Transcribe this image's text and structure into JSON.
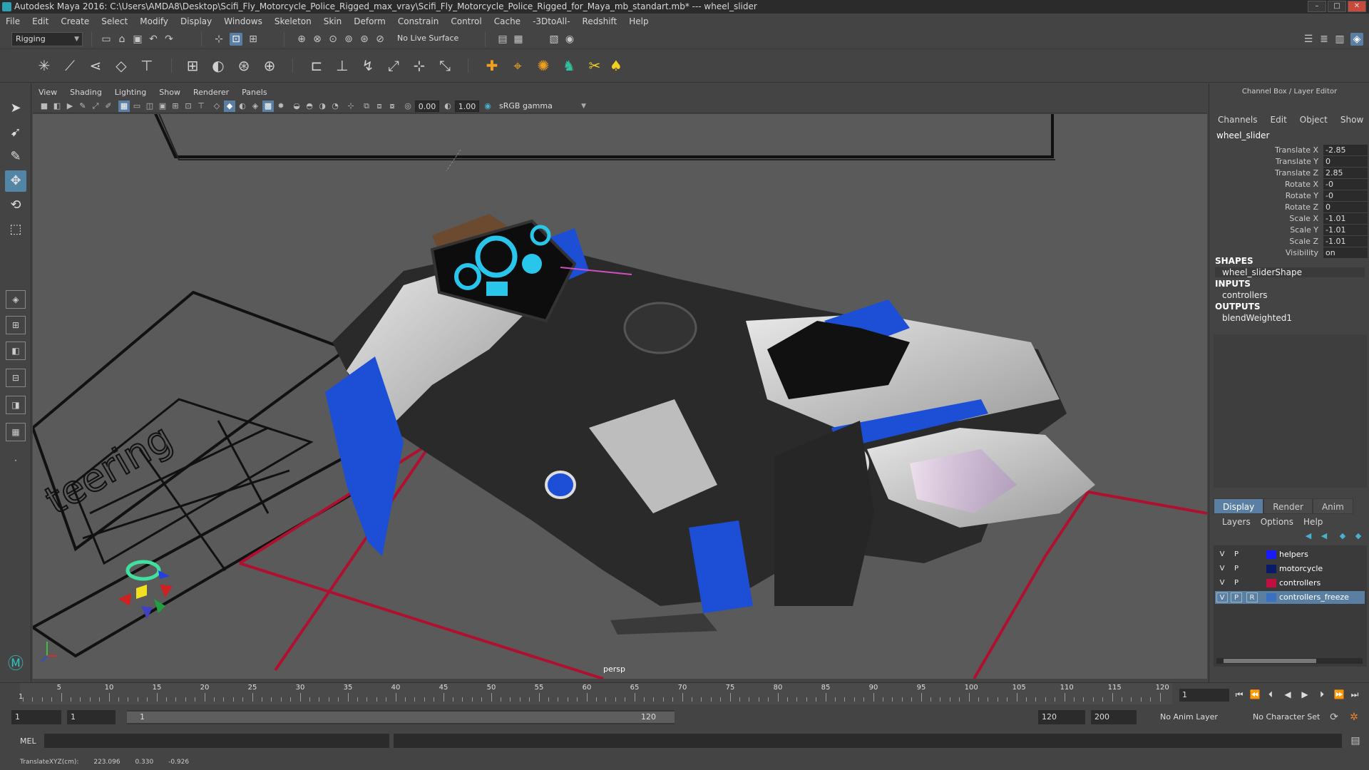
{
  "window": {
    "title": "Autodesk Maya 2016: C:\\Users\\AMDA8\\Desktop\\Scifi_Fly_Motorcycle_Police_Rigged_max_vray\\Scifi_Fly_Motorcycle_Police_Rigged_for_Maya_mb_standart.mb*  ---  wheel_slider"
  },
  "menubar": [
    "File",
    "Edit",
    "Create",
    "Select",
    "Modify",
    "Display",
    "Windows",
    "Skeleton",
    "Skin",
    "Deform",
    "Constrain",
    "Control",
    "Cache",
    "-3DtoAll-",
    "Redshift",
    "Help"
  ],
  "statusline": {
    "mode": "Rigging",
    "live_surface": "No Live Surface"
  },
  "viewport": {
    "menus": [
      "View",
      "Shading",
      "Lighting",
      "Show",
      "Renderer",
      "Panels"
    ],
    "exposure": "0.00",
    "gamma": "1.00",
    "colorspace": "sRGB gamma",
    "camera": "persp",
    "floor_text": "teering"
  },
  "channel_box": {
    "title": "Channel Box / Layer Editor",
    "menus": [
      "Channels",
      "Edit",
      "Object",
      "Show"
    ],
    "object": "wheel_slider",
    "channels": [
      {
        "label": "Translate X",
        "value": "-2.85"
      },
      {
        "label": "Translate Y",
        "value": "0"
      },
      {
        "label": "Translate Z",
        "value": "2.85"
      },
      {
        "label": "Rotate X",
        "value": "-0"
      },
      {
        "label": "Rotate Y",
        "value": "-0"
      },
      {
        "label": "Rotate Z",
        "value": "0"
      },
      {
        "label": "Scale X",
        "value": "-1.01"
      },
      {
        "label": "Scale Y",
        "value": "-1.01"
      },
      {
        "label": "Scale Z",
        "value": "-1.01"
      },
      {
        "label": "Visibility",
        "value": "on"
      }
    ],
    "shapes_label": "SHAPES",
    "shape": "wheel_sliderShape",
    "inputs_label": "INPUTS",
    "input": "controllers",
    "outputs_label": "OUTPUTS",
    "output": "blendWeighted1"
  },
  "layer_editor": {
    "tabs": [
      "Display",
      "Render",
      "Anim"
    ],
    "menus": [
      "Layers",
      "Options",
      "Help"
    ],
    "layers": [
      {
        "v": "V",
        "p": "P",
        "r": "",
        "name": "helpers",
        "color": "#1a1aff"
      },
      {
        "v": "V",
        "p": "P",
        "r": "",
        "name": "motorcycle",
        "color": "#0a1a6a"
      },
      {
        "v": "V",
        "p": "P",
        "r": "",
        "name": "controllers",
        "color": "#c01040"
      },
      {
        "v": "V",
        "p": "P",
        "r": "R",
        "name": "controllers_freeze",
        "color": "#3a70c0"
      }
    ]
  },
  "timeline": {
    "labels": [
      "5",
      "10",
      "15",
      "20",
      "25",
      "30",
      "35",
      "40",
      "45",
      "50",
      "55",
      "60",
      "65",
      "70",
      "75",
      "80",
      "85",
      "90",
      "95",
      "100",
      "105",
      "110",
      "115",
      "120"
    ],
    "start_label": "1",
    "current_frame": "1"
  },
  "range": {
    "start": "1",
    "anim_start": "1",
    "slider_start": "1",
    "slider_end": "120",
    "end": "120",
    "anim_end": "200",
    "anim_layer": "No Anim Layer",
    "character_set": "No Character Set"
  },
  "cmd": {
    "label": "MEL"
  },
  "help": {
    "label": "TranslateXYZ(cm):",
    "x": "223.096",
    "y": "0.330",
    "z": "-0.926"
  }
}
